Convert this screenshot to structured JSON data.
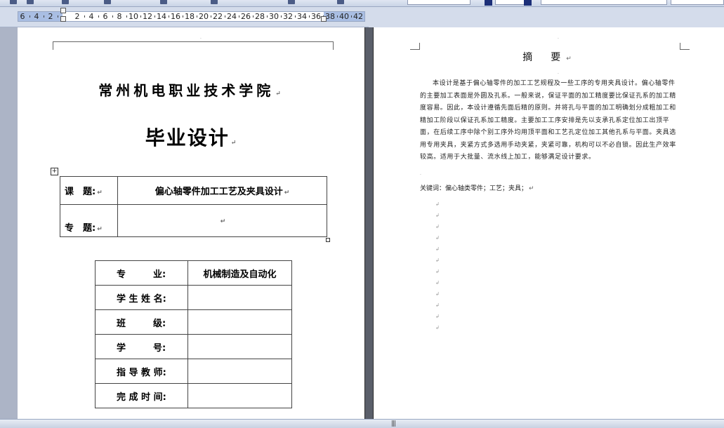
{
  "ruler": {
    "ticks": [
      "6",
      "4",
      "2",
      "2",
      "4",
      "6",
      "8",
      "10",
      "12",
      "14",
      "16",
      "18",
      "20",
      "22",
      "24",
      "26",
      "28",
      "30",
      "32",
      "34",
      "36",
      "38",
      "40",
      "42"
    ]
  },
  "left_page": {
    "school": "常州机电职业技术学院",
    "title": "毕业设计",
    "table_handle": "+",
    "topic_label": "课　题:",
    "topic_value": "偏心轴零件加工工艺及夹具设计",
    "subtopic_label": "专　题:",
    "subtopic_value": "",
    "info_rows": [
      {
        "label": "专　　　业:",
        "value": "机械制造及自动化"
      },
      {
        "label": "学 生 姓 名:",
        "value": ""
      },
      {
        "label": "班　　　级:",
        "value": ""
      },
      {
        "label": "学　　　号:",
        "value": ""
      },
      {
        "label": "指 导 教 师:",
        "value": ""
      },
      {
        "label": "完 成 时 间:",
        "value": ""
      }
    ]
  },
  "right_page": {
    "abstract_title": "摘　要",
    "abstract_body": "本设计是基于偏心轴零件的加工工艺规程及一些工序的专用夹具设计。偏心轴零件的主要加工表面是外圆及孔系。一般来说，保证平面的加工精度要比保证孔系的加工精度容易。因此，本设计遵循先面后精的原则。并将孔与平面的加工明确划分成粗加工和精加工阶段以保证孔系加工精度。主要加工工序安排是先以支承孔系定位加工出顶平面，在后续工序中除个别工序外均用顶平面和工艺孔定位加工其他孔系与平面。夹具选用专用夹具，夹紧方式多选用手动夹紧，夹紧可靠，机构可以不必自锁。因此生产效率较高。适用于大批量、流水线上加工，能够满足设计要求。",
    "keywords": "关键词：偏心轴类零件；工艺；夹具；"
  },
  "status": {
    "scroll_grip": "|||"
  },
  "colors": {
    "workspace": "#acb4c6",
    "ruler_margin": "#a9bee3",
    "ruler_bg": "#d4dceb",
    "page": "#ffffff"
  },
  "marks": {
    "para": "↵",
    "empty": "↲"
  }
}
